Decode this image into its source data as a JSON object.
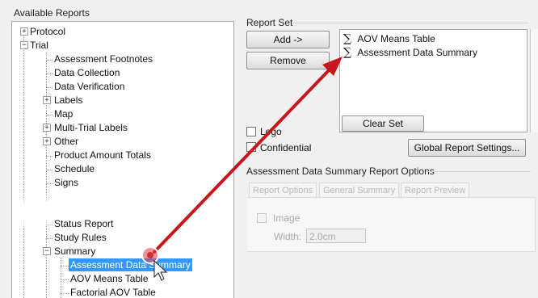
{
  "available_reports": {
    "label": "Available Reports",
    "tree": [
      {
        "label": "Protocol",
        "expander": "+"
      },
      {
        "label": "Trial",
        "expander": "−"
      },
      {
        "label": "Assessment Footnotes"
      },
      {
        "label": "Data Collection"
      },
      {
        "label": "Data Verification"
      },
      {
        "label": "Labels",
        "expander": "+"
      },
      {
        "label": "Map"
      },
      {
        "label": "Multi-Trial Labels",
        "expander": "+"
      },
      {
        "label": "Other",
        "expander": "+"
      },
      {
        "label": "Product Amount Totals"
      },
      {
        "label": "Schedule"
      },
      {
        "label": "Signs"
      },
      {
        "label": "Status Report"
      },
      {
        "label": "Study Rules"
      },
      {
        "label": "Summary",
        "expander": "−"
      },
      {
        "label": "Assessment Data Summary"
      },
      {
        "label": "AOV Means Table"
      },
      {
        "label": "Factorial AOV Table"
      }
    ]
  },
  "report_set": {
    "label": "Report Set",
    "add_label": "Add ->",
    "remove_label": "Remove",
    "items": [
      {
        "label": "AOV Means Table",
        "icon": "sigma-icon"
      },
      {
        "label": "Assessment Data Summary",
        "icon": "sigma-icon"
      }
    ],
    "clear_label": "Clear Set"
  },
  "options": {
    "logo_label": "Logo",
    "confidential_label": "Confidential",
    "global_settings_label": "Global Report Settings..."
  },
  "report_options": {
    "title": "Assessment Data Summary Report Options",
    "tabs": [
      "Report Options",
      "General Summary",
      "Report Preview"
    ],
    "image_label": "Image",
    "width_label": "Width:",
    "width_value": "2.0cm"
  },
  "colors": {
    "selection": "#3399ff",
    "arrow": "#c8161d"
  }
}
